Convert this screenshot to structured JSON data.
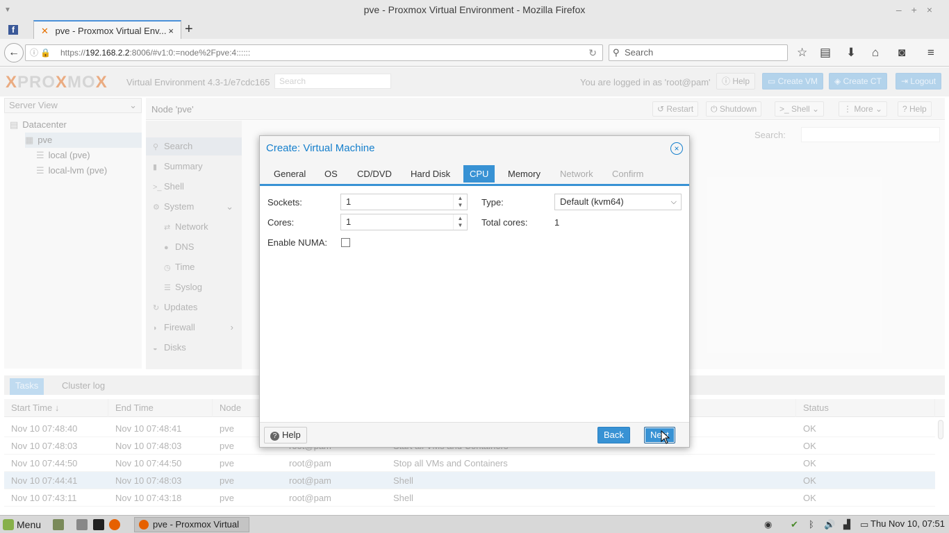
{
  "window": {
    "title": "pve - Proxmox Virtual Environment - Mozilla Firefox"
  },
  "browser": {
    "tab_label": "pve - Proxmox Virtual Env...",
    "url_host": "192.168.2.2",
    "url_prefix": "https://",
    "url_suffix": ":8006/#v1:0:=node%2Fpve:4::::::",
    "search_placeholder": "Search"
  },
  "header": {
    "brand_a": "PRO",
    "brand_x": "X",
    "brand_b": "MO",
    "brand_c": "X",
    "version": "Virtual Environment 4.3-1/e7cdc165",
    "search_placeholder": "Search",
    "logged_in": "You are logged in as 'root@pam'",
    "help": "Help",
    "create_vm": "Create VM",
    "create_ct": "Create CT",
    "logout": "Logout"
  },
  "tree": {
    "view": "Server View",
    "items": [
      "Datacenter",
      "pve",
      "local (pve)",
      "local-lvm (pve)"
    ]
  },
  "node": {
    "title": "Node 'pve'",
    "restart": "Restart",
    "shutdown": "Shutdown",
    "shell": "Shell",
    "more": "More",
    "help": "Help"
  },
  "node_menu": [
    {
      "label": "Search",
      "icon": "search-icon"
    },
    {
      "label": "Summary",
      "icon": "book-icon"
    },
    {
      "label": "Shell",
      "icon": "terminal-icon"
    },
    {
      "label": "System",
      "icon": "gears-icon"
    },
    {
      "label": "Network",
      "icon": "exchange-icon"
    },
    {
      "label": "DNS",
      "icon": "globe-icon"
    },
    {
      "label": "Time",
      "icon": "clock-icon"
    },
    {
      "label": "Syslog",
      "icon": "list-icon"
    },
    {
      "label": "Updates",
      "icon": "refresh-icon"
    },
    {
      "label": "Firewall",
      "icon": "shield-icon"
    },
    {
      "label": "Disks",
      "icon": "disk-icon"
    }
  ],
  "content": {
    "search_label": "Search:"
  },
  "tasks": {
    "tab_tasks": "Tasks",
    "tab_cluster": "Cluster log",
    "columns": [
      "Start Time ↓",
      "End Time",
      "Node",
      "",
      "",
      "Status"
    ],
    "rows": [
      [
        "Nov 10 07:48:40",
        "Nov 10 07:48:41",
        "pve",
        "",
        "",
        "OK"
      ],
      [
        "Nov 10 07:48:03",
        "Nov 10 07:48:03",
        "pve",
        "root@pam",
        "Start all VMs and Containers",
        "OK"
      ],
      [
        "Nov 10 07:44:50",
        "Nov 10 07:44:50",
        "pve",
        "root@pam",
        "Stop all VMs and Containers",
        "OK"
      ],
      [
        "Nov 10 07:44:41",
        "Nov 10 07:48:03",
        "pve",
        "root@pam",
        "Shell",
        "OK"
      ],
      [
        "Nov 10 07:43:11",
        "Nov 10 07:43:18",
        "pve",
        "root@pam",
        "Shell",
        "OK"
      ]
    ]
  },
  "modal": {
    "title": "Create: Virtual Machine",
    "tabs": [
      {
        "label": "General",
        "state": "normal"
      },
      {
        "label": "OS",
        "state": "normal"
      },
      {
        "label": "CD/DVD",
        "state": "normal"
      },
      {
        "label": "Hard Disk",
        "state": "normal"
      },
      {
        "label": "CPU",
        "state": "active"
      },
      {
        "label": "Memory",
        "state": "normal"
      },
      {
        "label": "Network",
        "state": "disabled"
      },
      {
        "label": "Confirm",
        "state": "disabled"
      }
    ],
    "sockets_label": "Sockets:",
    "sockets_value": "1",
    "cores_label": "Cores:",
    "cores_value": "1",
    "numa_label": "Enable NUMA:",
    "numa_checked": false,
    "type_label": "Type:",
    "type_value": "Default (kvm64)",
    "total_cores_label": "Total cores:",
    "total_cores_value": "1",
    "help": "Help",
    "back": "Back",
    "next": "Next"
  },
  "taskbar": {
    "menu": "Menu",
    "window": "pve - Proxmox Virtual ...",
    "clock": "Thu Nov 10, 07:51"
  },
  "colors": {
    "accent": "#3892d4",
    "title_blue": "#157fcc"
  }
}
